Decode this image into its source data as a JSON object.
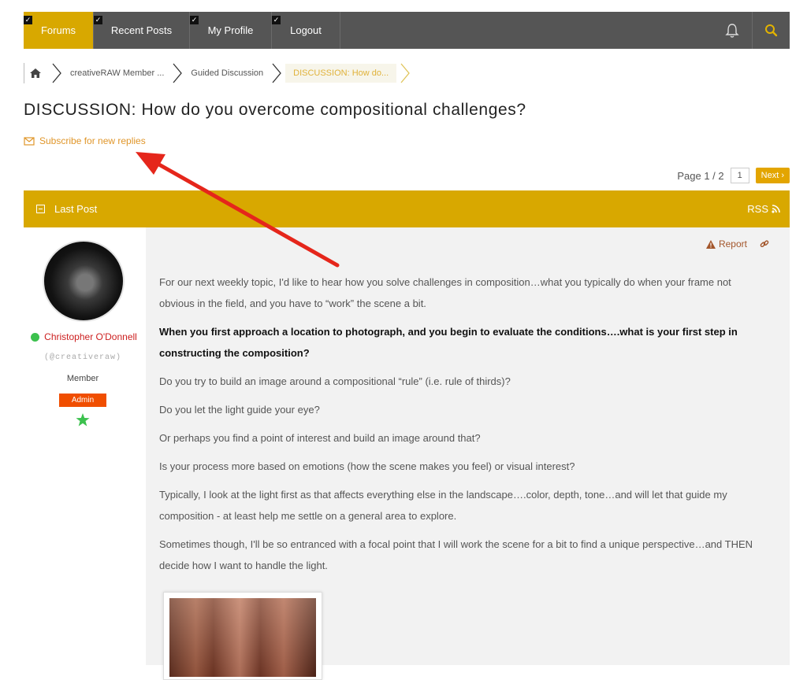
{
  "nav": {
    "tabs": [
      {
        "label": "Forums",
        "active": true
      },
      {
        "label": "Recent Posts",
        "active": false
      },
      {
        "label": "My Profile",
        "active": false
      },
      {
        "label": "Logout",
        "active": false
      }
    ],
    "icons": {
      "notifications": "bell-icon",
      "search": "search-icon"
    }
  },
  "breadcrumb": {
    "items": [
      "creativeRAW Member ...",
      "Guided Discussion"
    ],
    "current": "DISCUSSION: How do..."
  },
  "topic": {
    "title": "DISCUSSION: How do you overcome compositional challenges?",
    "subscribe": "Subscribe for new replies"
  },
  "pagination": {
    "label": "Page 1 / 2",
    "current_page": "1",
    "next": "Next"
  },
  "post_header": {
    "label": "Last Post",
    "rss": "RSS"
  },
  "author": {
    "name": "Christopher O'Donnell",
    "handle": "(@creativeraw)",
    "role": "Member",
    "badge": "Admin",
    "status": "online"
  },
  "post": {
    "report": "Report",
    "paragraphs": [
      "For our next weekly topic, I'd like to hear how you solve challenges in composition…what you typically do when your frame not obvious in the field, and you have to “work” the scene a bit.",
      "When you first approach a location to photograph, and you begin to evaluate the conditions….what is your first step in constructing the composition?",
      "Do you try to build an image around a compositional “rule” (i.e. rule of thirds)?",
      "Do you let the light guide your eye?",
      "Or perhaps you find a point of interest and build an image around that?",
      "Is your process more based on emotions (how the scene makes you feel) or visual interest?",
      "Typically, I look at the light first as that affects everything else in the landscape….color, depth, tone…and will let that guide my composition - at least help me settle on a general area to explore.",
      "Sometimes though, I'll be so entranced with a focal point that I will work the scene for a bit to find a unique perspective…and THEN decide how I want to handle the light."
    ]
  },
  "colors": {
    "nav_bg": "#555555",
    "accent": "#d8a800",
    "link": "#e0962a",
    "author_name": "#cc1f1f",
    "admin_badge": "#f04e00",
    "annotation_arrow": "#e5261b"
  }
}
